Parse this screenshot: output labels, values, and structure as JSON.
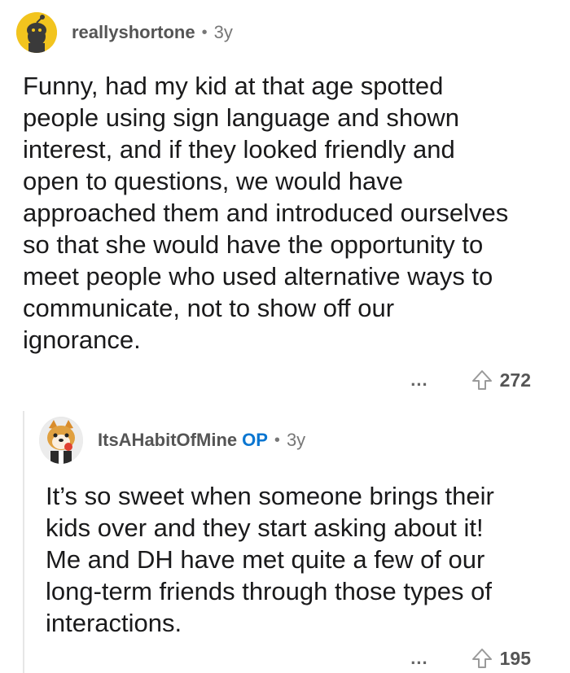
{
  "comments": [
    {
      "author": "reallyshortone",
      "separator": "•",
      "age": "3y",
      "body": "Funny, had my kid at that age spotted\npeople using sign language and shown\ninterest, and if they looked friendly and\nopen to questions, we would have\napproached them and introduced ourselves\nso that she would have the opportunity to\nmeet people who used alternative ways to\ncommunicate, not to show off our\nignorance.",
      "more": "...",
      "score": "272"
    },
    {
      "author": "ItsAHabitOfMine",
      "op_badge": "OP",
      "separator": "•",
      "age": "3y",
      "body": "It’s so sweet when someone brings their\nkids over and they start asking about it!\nMe and DH have met quite a few of our\nlong-term friends through those types of\ninteractions.",
      "more": "...",
      "score": "195"
    }
  ],
  "colors": {
    "accent_op": "#0a76d1",
    "meta_text": "#777777",
    "avatar_yellow": "#f0c020"
  },
  "icons": {
    "avatar_1": "snoo-avatar-icon",
    "avatar_2": "shiba-avatar-icon",
    "upvote": "upvote-arrow-icon",
    "more": "more-options-icon"
  }
}
